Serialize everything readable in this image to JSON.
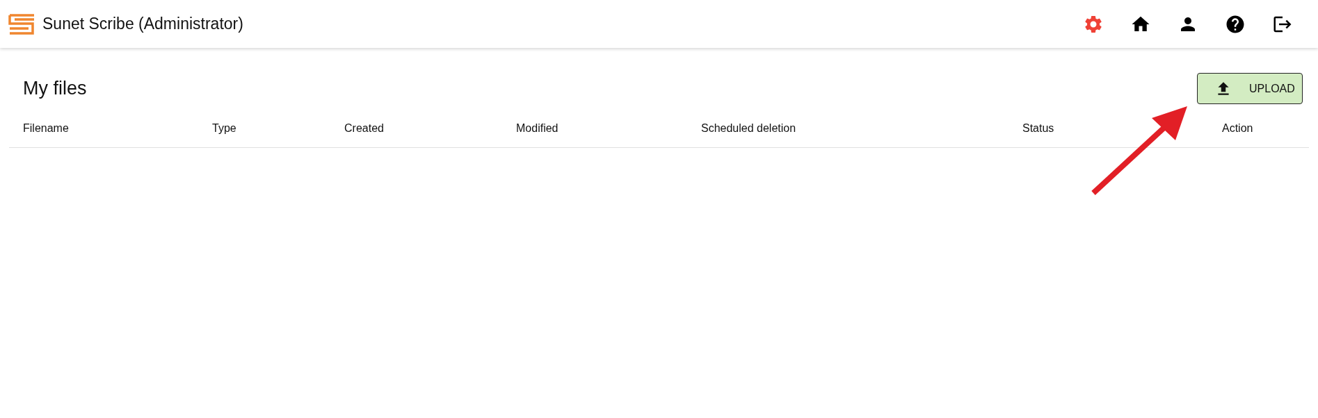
{
  "header": {
    "title": "Sunet Scribe (Administrator)",
    "nav": [
      {
        "kind": "settings",
        "selected": true
      },
      {
        "kind": "home",
        "selected": false
      },
      {
        "kind": "account",
        "selected": false
      },
      {
        "kind": "help",
        "selected": false
      },
      {
        "kind": "logout",
        "selected": false
      }
    ]
  },
  "page": {
    "title": "My files",
    "upload_button": "UPLOAD"
  },
  "table": {
    "columns": [
      "Filename",
      "Type",
      "Created",
      "Modified",
      "Scheduled deletion",
      "Status",
      "Action"
    ]
  },
  "annotation": {
    "kind": "arrow"
  }
}
